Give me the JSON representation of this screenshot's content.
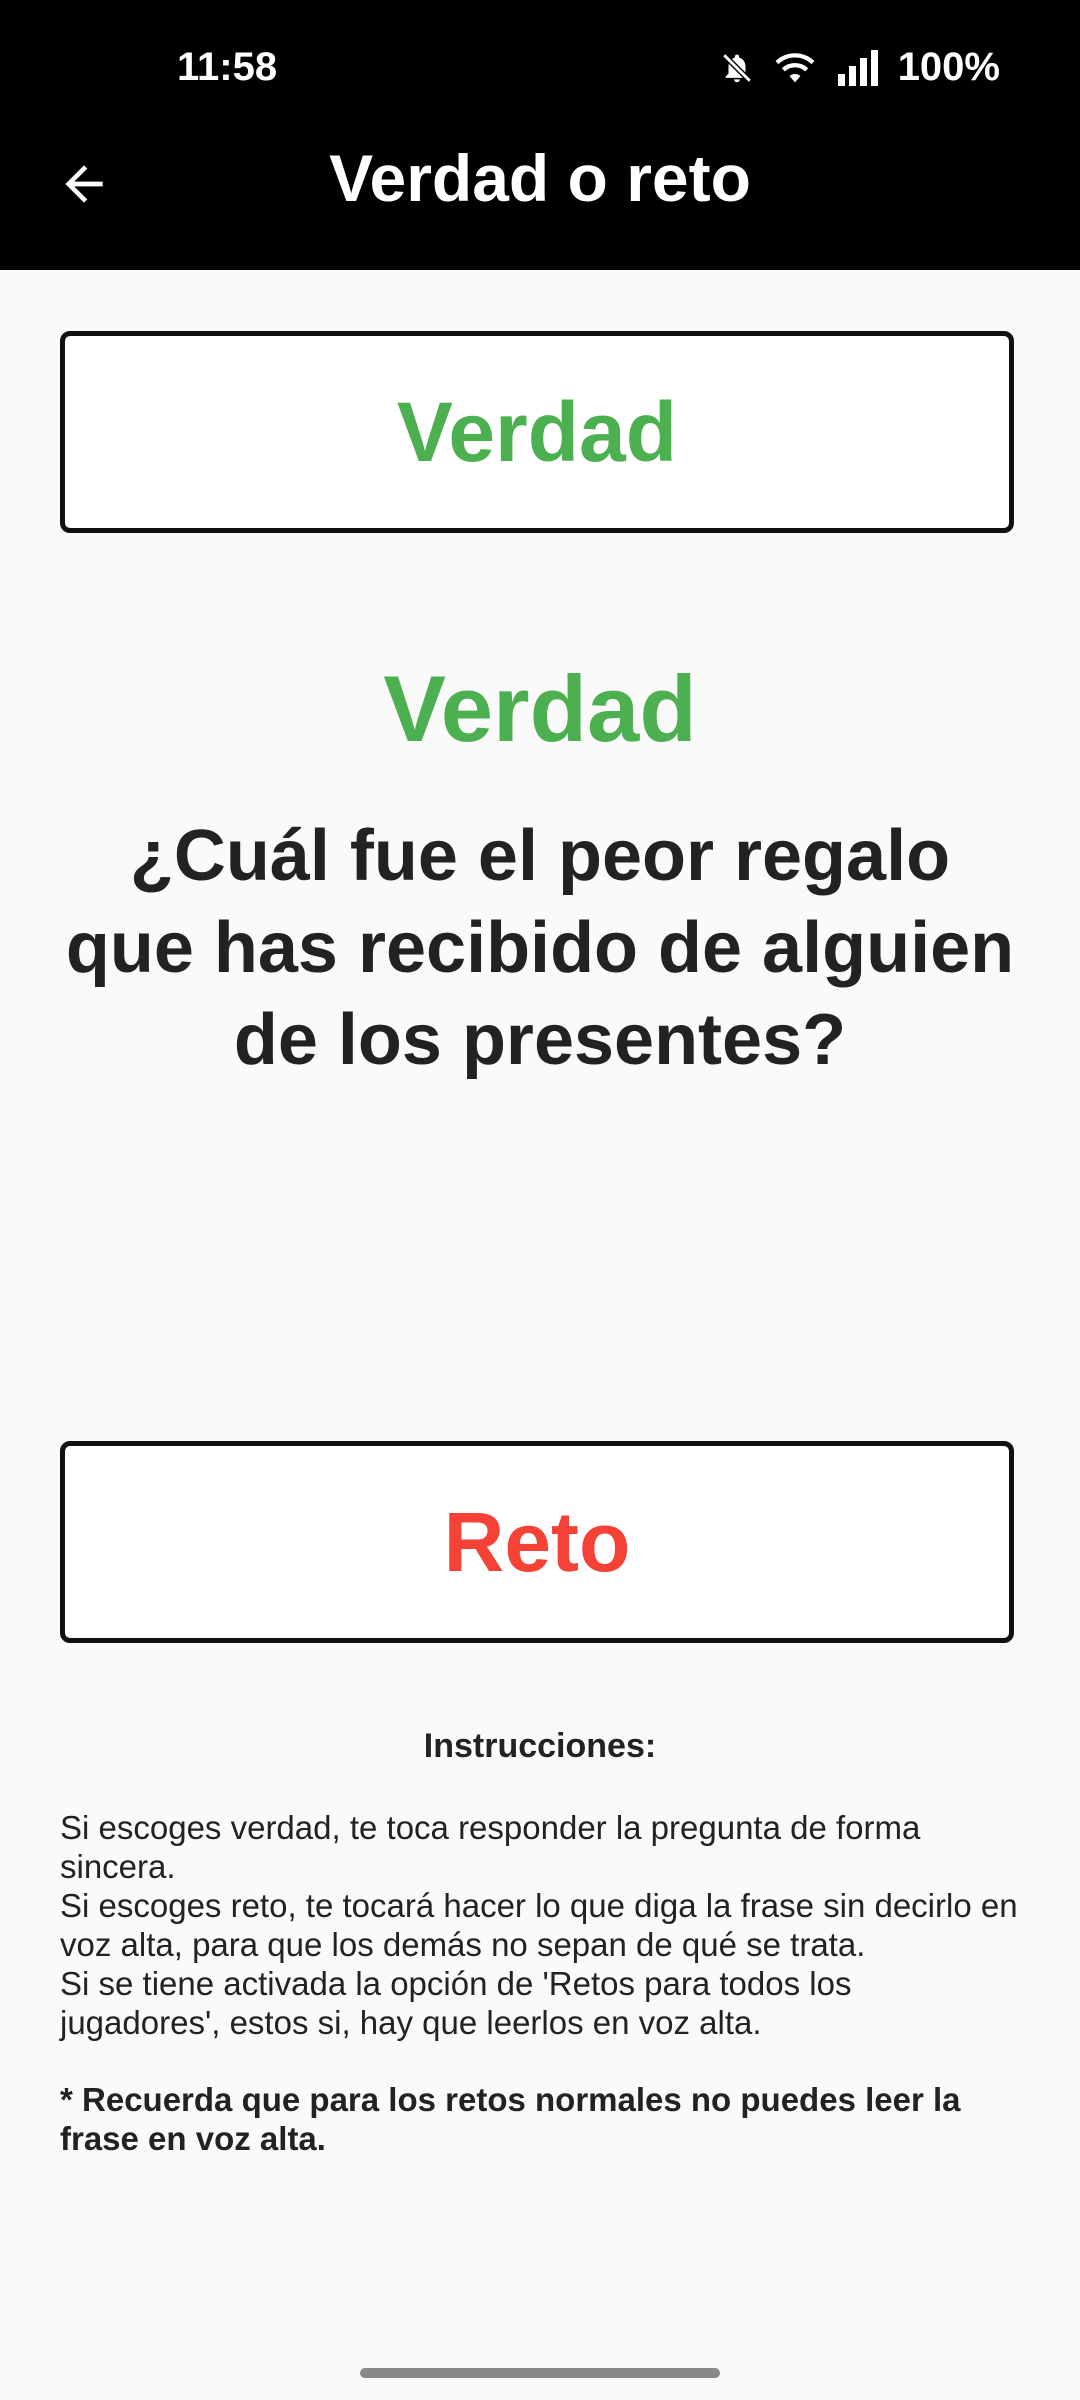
{
  "status_bar": {
    "time": "11:58",
    "battery": "100%",
    "icons": [
      "bell-muted-icon",
      "wifi-icon",
      "signal-icon"
    ]
  },
  "app_bar": {
    "back_icon": "arrow-left-icon",
    "title": "Verdad o reto"
  },
  "buttons": {
    "truth_label": "Verdad",
    "dare_label": "Reto"
  },
  "result": {
    "type": "Verdad",
    "text": "¿Cuál fue el peor regalo que has recibido de alguien de los presentes?"
  },
  "instructions": {
    "title": "Instrucciones:",
    "lines": [
      "Si escoges verdad, te toca responder la pregunta de forma sincera.",
      "Si escoges reto, te tocará hacer lo que diga la frase sin decirlo en voz alta, para que los demás no sepan de qué se trata.",
      "Si se tiene activada la opción de 'Retos para todos los jugadores', estos si, hay que leerlos en voz alta."
    ],
    "note": "* Recuerda que para los retos normales no puedes leer la frase en voz alta."
  },
  "colors": {
    "truth": "#4caf50",
    "dare": "#f44336",
    "app_bar": "#000000",
    "background": "#fafafa"
  }
}
